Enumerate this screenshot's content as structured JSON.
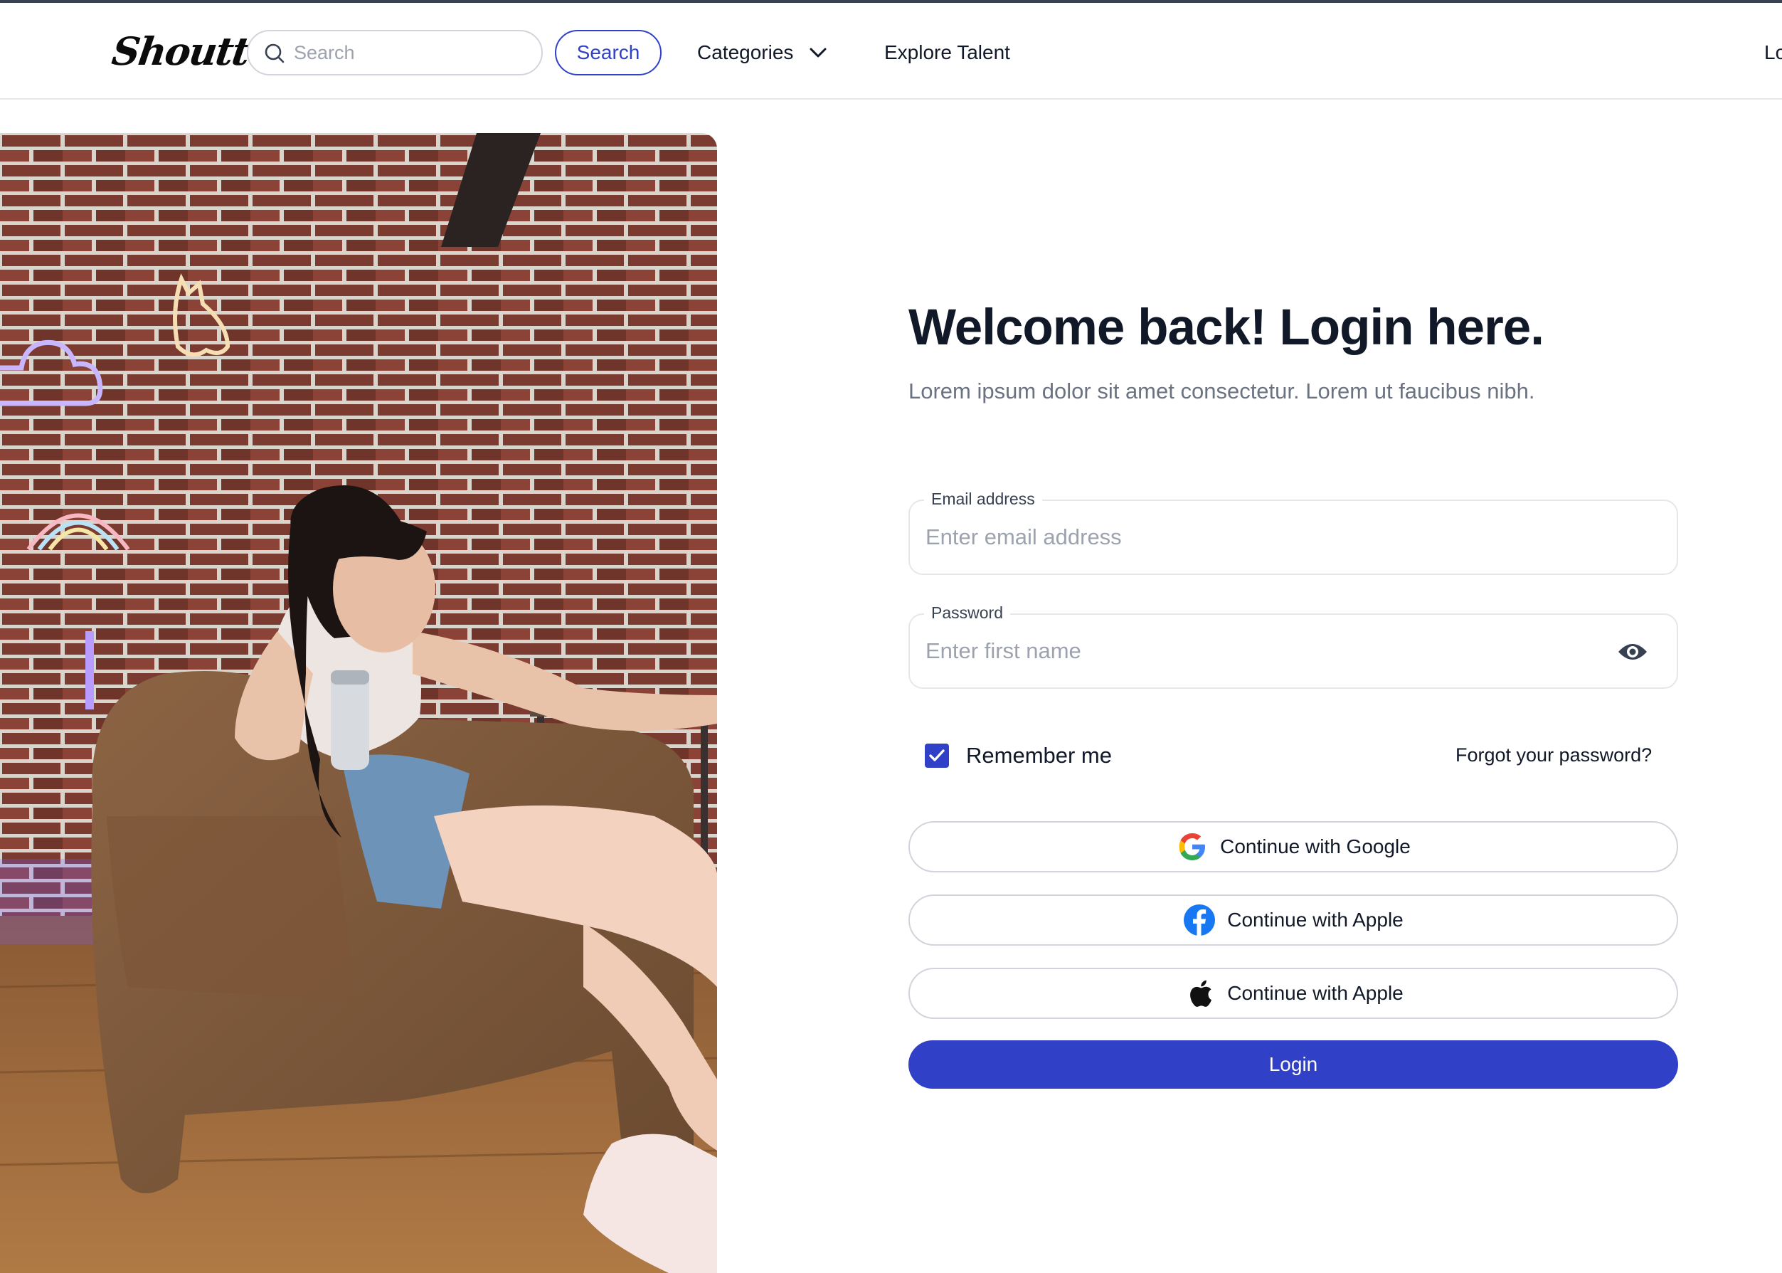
{
  "header": {
    "logo": "Shoutt",
    "search_placeholder": "Search",
    "search_button": "Search",
    "categories": "Categories",
    "explore_talent": "Explore Talent",
    "login_link": "Lo"
  },
  "hero": {
    "image_icon": "photo-woman-in-armchair"
  },
  "form": {
    "title": "Welcome back! Login here.",
    "subtitle": "Lorem ipsum dolor sit amet consectetur. Lorem ut faucibus nibh.",
    "email_label": "Email address",
    "email_placeholder": "Enter email address",
    "email_value": "",
    "password_label": "Password",
    "password_placeholder": "Enter first name",
    "password_value": "",
    "remember_label": "Remember me",
    "remember_checked": true,
    "forgot_label": "Forgot your password?",
    "google_label": "Continue with Google",
    "facebook_label": "Continue with Apple",
    "apple_label": "Continue with Apple",
    "login_label": "Login"
  },
  "colors": {
    "accent": "#3040c7",
    "text": "#111827",
    "muted": "#6b7280",
    "border": "#d1d5db"
  }
}
